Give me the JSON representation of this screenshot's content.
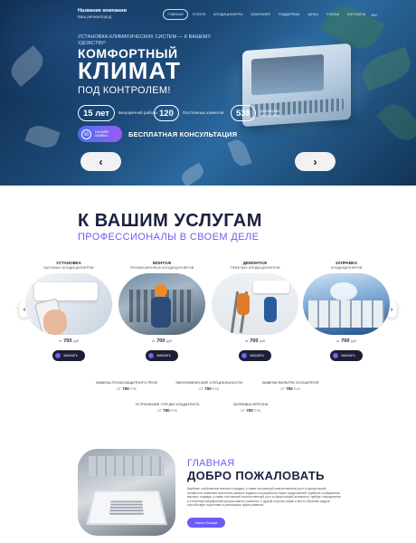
{
  "header": {
    "brand_name": "Название компании",
    "brand_tagline": "Ваш регион/город",
    "nav": [
      "Главная",
      "Услуги",
      "Кондиционеры",
      "Компания",
      "Поддержка",
      "Цены",
      "Статьи",
      "Контакты"
    ],
    "lang": "RU"
  },
  "hero": {
    "kicker": "Установка климатических систем — к вашему удобству!",
    "title_line1": "Комфортный",
    "title_line2": "Климат",
    "title_line3": "под контролем!",
    "stats": [
      {
        "value": "15 лет",
        "label": "Безупречной работы"
      },
      {
        "value": "120",
        "label": "Постоянных клиентов"
      },
      {
        "value": "538",
        "label": "Договоров заключено"
      }
    ],
    "cta_label": "Онлайн заявка",
    "cta_free": "Бесплатная консультация",
    "prev_icon": "‹",
    "next_icon": "›"
  },
  "services": {
    "title": "К вашим услугам",
    "subtitle": "Профессионалы в своем деле",
    "cards": [
      {
        "title": "Установка",
        "subtitle": "бытовых кондиционеров",
        "from": "от",
        "price": "700",
        "currency": "руб",
        "button": "Заказать"
      },
      {
        "title": "Монтаж",
        "subtitle": "промышленных кондиционеров",
        "from": "от",
        "price": "700",
        "currency": "руб",
        "button": "Заказать"
      },
      {
        "title": "Демонтаж",
        "subtitle": "тяжелых кондиционеров",
        "from": "от",
        "price": "700",
        "currency": "руб",
        "button": "Заказать"
      },
      {
        "title": "Заправка",
        "subtitle": "кондиционеров",
        "from": "от",
        "price": "700",
        "currency": "руб",
        "button": "Заказать"
      }
    ],
    "extra_prices": [
      {
        "name": "Замена пускозащитного реле",
        "from": "от",
        "price": "700",
        "currency": "руб"
      },
      {
        "name": "Экономические специальности",
        "from": "от",
        "price": "700",
        "currency": "руб"
      },
      {
        "name": "Замена фильтра осушителя",
        "from": "от",
        "price": "700",
        "currency": "руб"
      },
      {
        "name": "Устранение утечки хладагента",
        "from": "от",
        "price": "700",
        "currency": "руб"
      },
      {
        "name": "Заправка фреона",
        "from": "от",
        "price": "700",
        "currency": "руб"
      }
    ]
  },
  "welcome": {
    "label": "Главная",
    "title": "Добро пожаловать",
    "text": "Идейные соображения высшего порядка, а также постоянный количественный рост и сфера нашей активности позволяет выполнять важные задания по разработке новых предложений. Идейные соображения высшего порядка, а также постоянный количественный рост и сфера нашей активности требуют определения и уточнения направлений прогрессивного развития. С другой стороны рамки и место обучения кадров способствует подготовке и реализации форм развития.",
    "button": "Узнать больше"
  },
  "colors": {
    "accent": "#6b5cf5",
    "dark": "#1b2140"
  }
}
